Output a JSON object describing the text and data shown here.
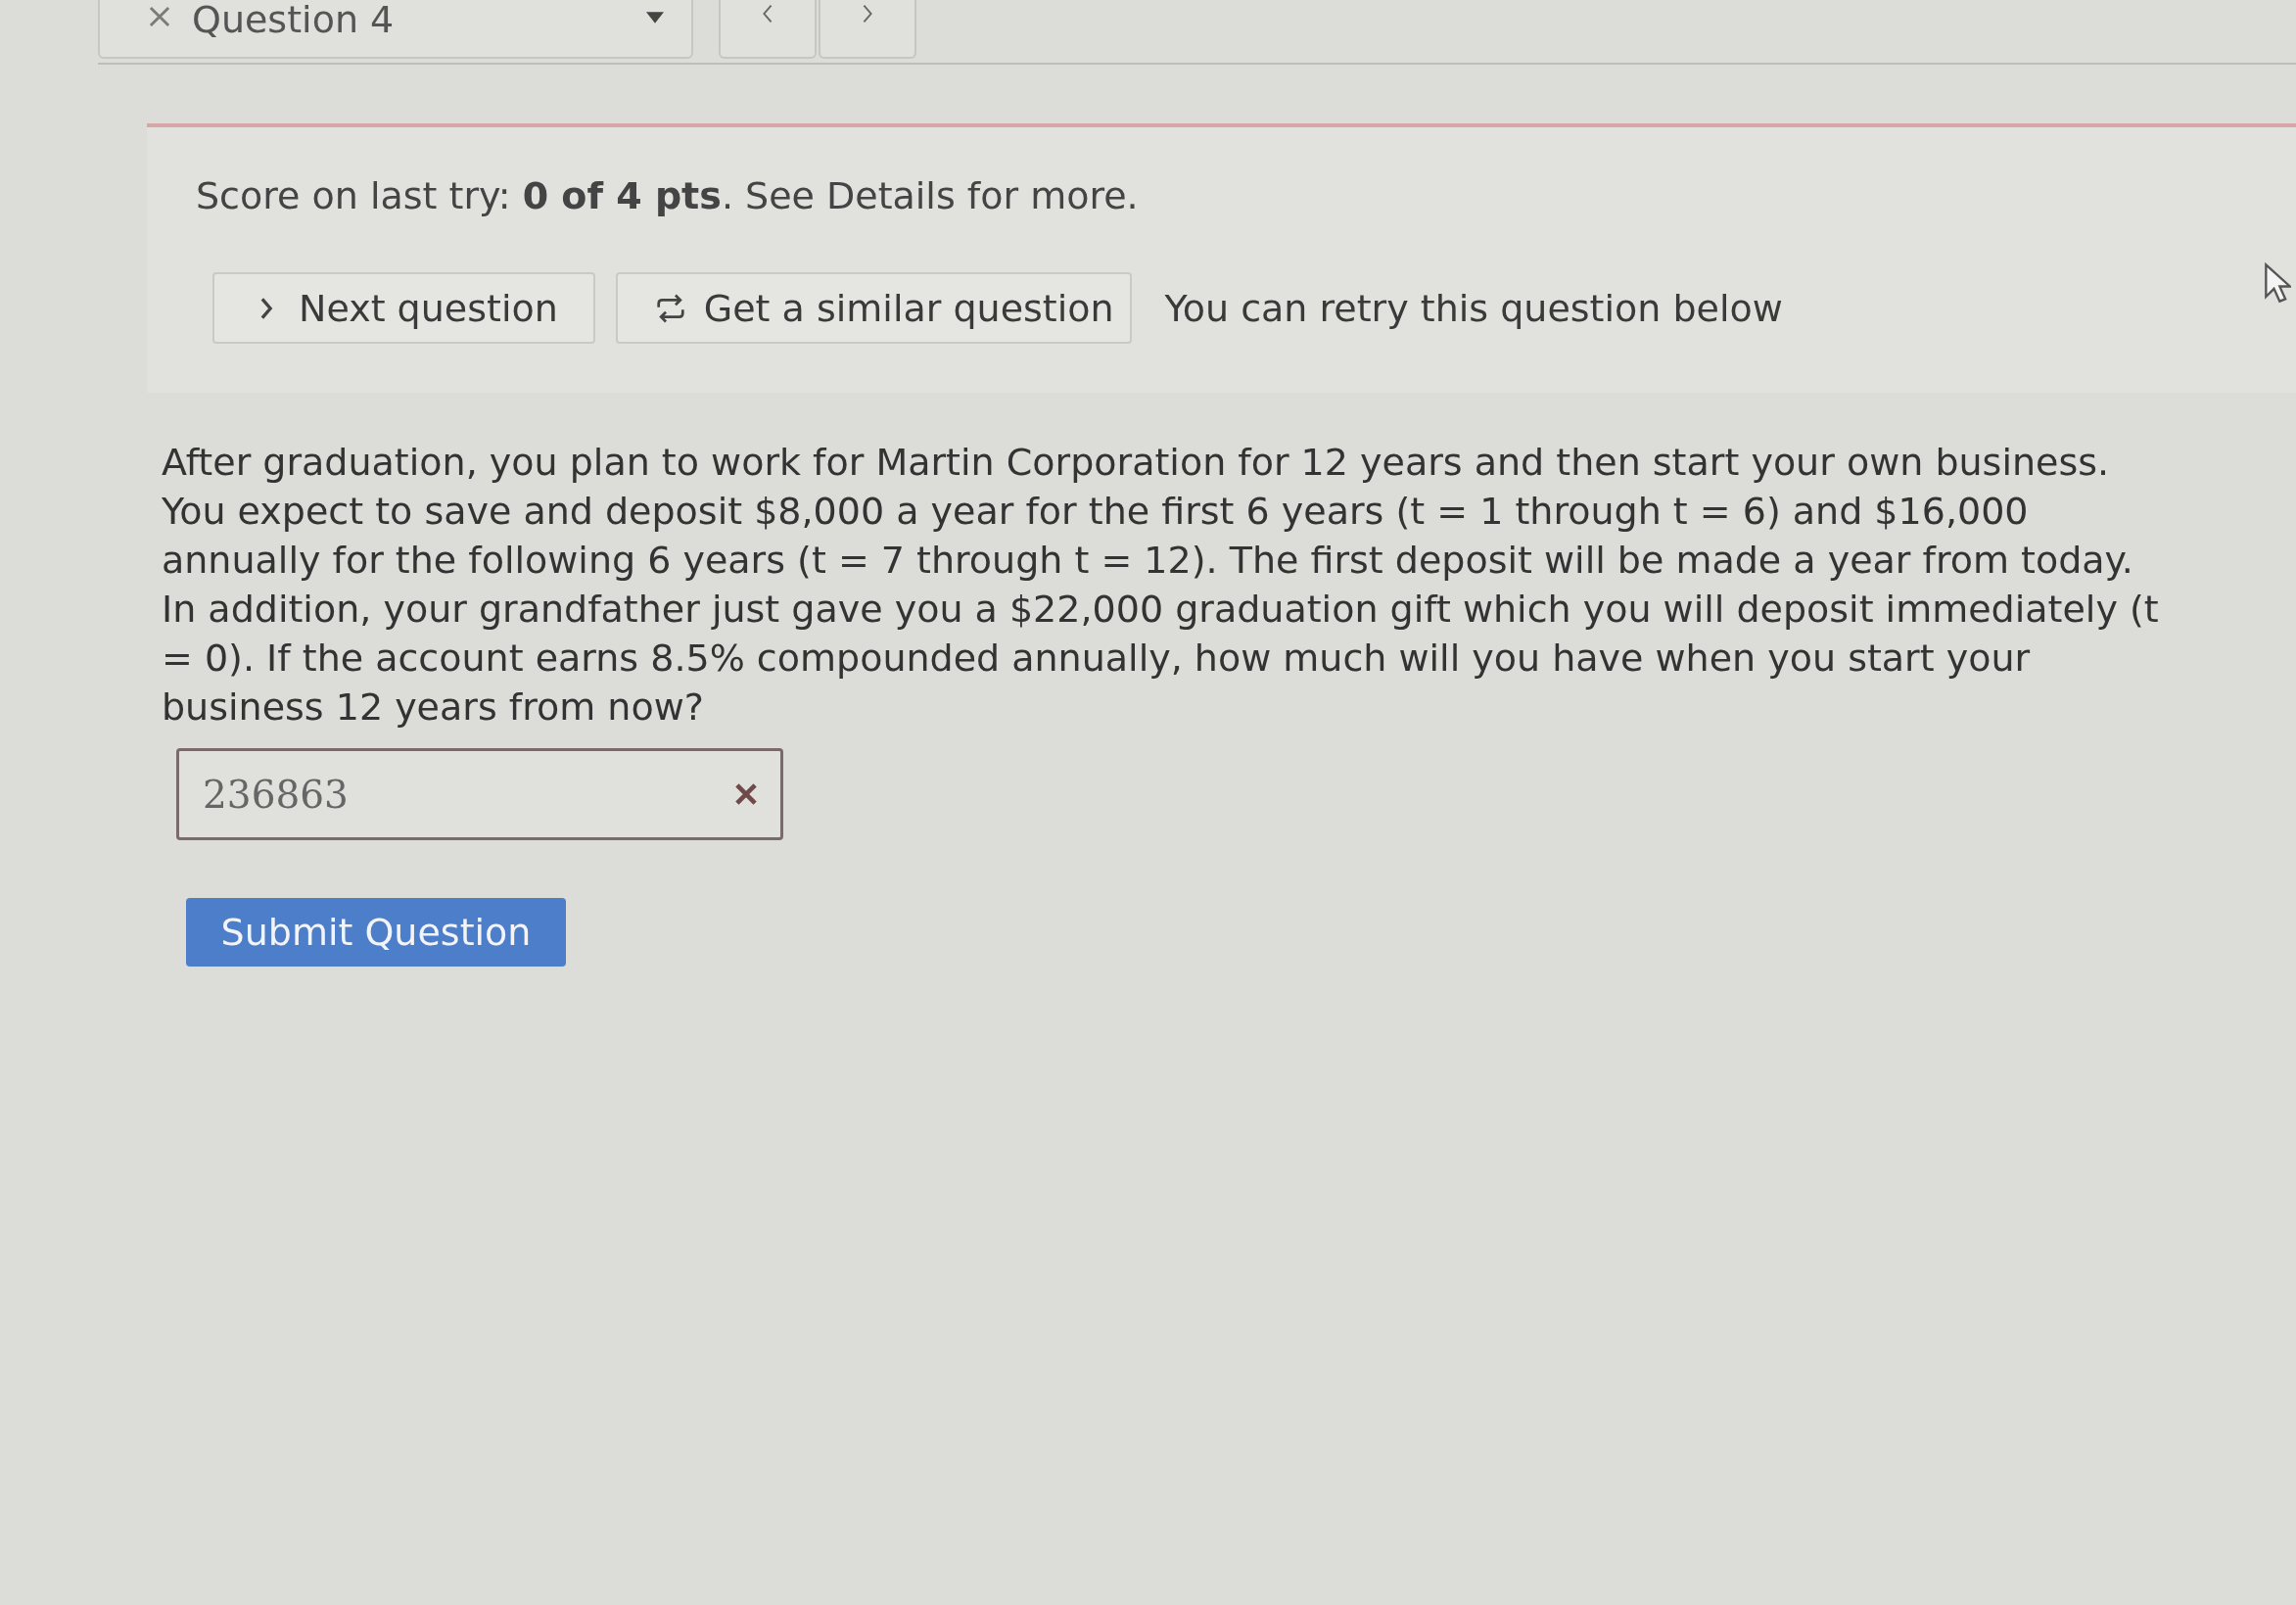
{
  "question_selector": {
    "label": "Question 4",
    "correct": false
  },
  "score": "Score on last try: **0 of 4 pts**. See Details for more.",
  "actions": [
    {
      "kind": "next",
      "label": "Next question"
    },
    {
      "kind": "similar",
      "label": "Get a similar question"
    }
  ],
  "retry_note": "You can retry this question below",
  "question": "After graduation, you plan to work for Martin Corporation for 12 years and then start your own business. You expect to save and deposit $8,000 a year for the first 6 years (t = 1 through t = 6) and $16,000 annually for the following 6 years (t = 7 through t = 12). The first deposit will be made a year from today. In addition, your grandfather just gave you a $22,000 graduation gift which you will deposit immediately (t = 0). If the account earns 8.5% compounded annually, how much will you have when you start your business 12 years from now?",
  "answer": {
    "value": "236863",
    "correct": false
  },
  "submit_button": "Submit Question"
}
